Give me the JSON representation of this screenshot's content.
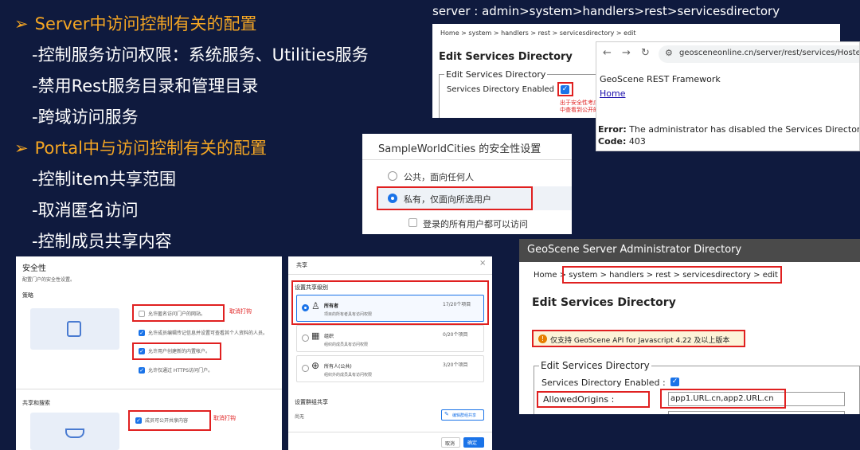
{
  "bullets": {
    "server_head": "Server中访问控制有关的配置",
    "server_1": "-控制服务访问权限：系统服务、Utilities服务",
    "server_2": "-禁用Rest服务目录和管理目录",
    "server_3": "-跨域访问服务",
    "portal_head": "Portal中与访问控制有关的配置",
    "portal_1": "-控制item共享范围",
    "portal_2": "-取消匿名访问",
    "portal_3": "-控制成员共享内容",
    "arrow": "➢"
  },
  "path_caption": "server : admin>system>handlers>rest>servicesdirectory",
  "edit_shot": {
    "breadcrumb": "Home > system > handlers > rest > servicesdirectory > edit",
    "title": "Edit Services Directory",
    "legend": "Edit Services Directory",
    "enabled_label": "Services Directory Enabled :",
    "note": "出于安全性考虑，\n中查看到公开的"
  },
  "browser": {
    "url": "geosceneonline.cn/server/rest/services/Hosted/S",
    "framework": "GeoScene REST Framework",
    "home_link": "Home",
    "error_label": "Error:",
    "error_text": " The administrator has disabled the Services Directory.",
    "code_label": "Code:",
    "code_value": " 403"
  },
  "security": {
    "title": "SampleWorldCities 的安全性设置",
    "option_public": "公共，面向任何人",
    "option_private": "私有，仅面向所选用户",
    "option_all_users": "登录的所有用户都可以访问"
  },
  "portal_security": {
    "title": "安全性",
    "desc": "配置门户的安全性设置。",
    "policy": "策略",
    "opt_anon": "允许匿名访问门户的网站。",
    "opt_members": "允许成员编辑传记信息并设置可查看其个人资料的人员。",
    "opt_builtin": "允许用户创建新的内置帐户。",
    "opt_https": "允许仅通过 HTTPS访问门户。",
    "cancel_hint": "取消打钩",
    "share_search": "共享和搜索",
    "opt_member_share": "成员可公开共享内容",
    "cancel_hint2": "取消打钩"
  },
  "share_dialog": {
    "title": "共享",
    "close": "×",
    "level_title": "设置共享级别",
    "owner_name": "所有者",
    "owner_desc": "项目的所有者具有访问权限",
    "owner_count": "17/20个项目",
    "org_name": "组织",
    "org_desc": "组织的成员具有访问权限",
    "org_count": "0/20个项目",
    "public_name": "所有人(公共)",
    "public_desc": "组织外的成员具有访问权限",
    "public_count": "3/20个项目",
    "group_title": "设置群组共享",
    "group_none": "尚无",
    "edit_group": "编辑群组共享",
    "cancel": "取消",
    "ok": "确定"
  },
  "admin_dir": {
    "header": "GeoScene Server Administrator Directory",
    "breadcrumb_home": "Home",
    "breadcrumb_rest": " > system > handlers > rest > servicesdirectory > edit",
    "title": "Edit Services Directory",
    "warning": "仅支持 GeoScene API for Javascript 4.22 及以上版本",
    "legend": "Edit Services Directory",
    "enabled_label": "Services Directory Enabled :",
    "origins_label": "AllowedOrigins :",
    "origins_value": "app1.URL.cn,app2.URL.cn"
  }
}
